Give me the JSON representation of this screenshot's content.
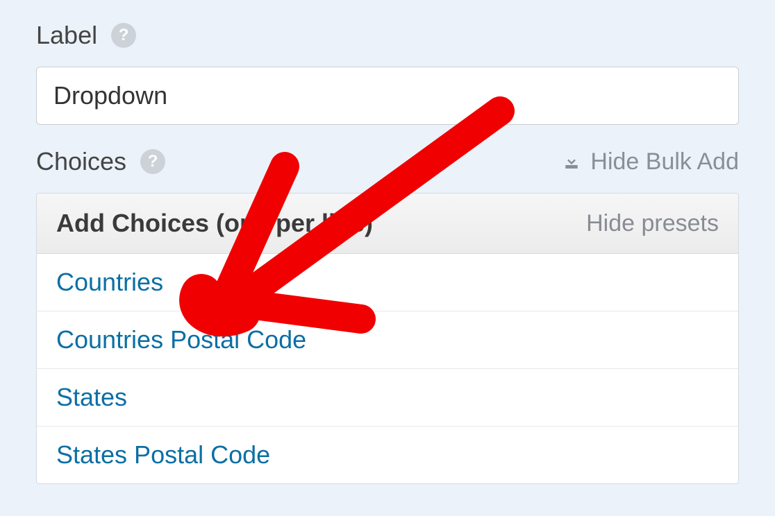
{
  "label_section": {
    "title": "Label",
    "input_value": "Dropdown"
  },
  "choices_section": {
    "title": "Choices",
    "hide_bulk_add": "Hide Bulk Add"
  },
  "panel": {
    "title": "Add Choices (one per line)",
    "hide_presets": "Hide presets",
    "presets": [
      "Countries",
      "Countries Postal Code",
      "States",
      "States Postal Code"
    ]
  },
  "annotation": {
    "color": "#f00000",
    "description": "hand-drawn red arrow pointing at Countries preset"
  }
}
